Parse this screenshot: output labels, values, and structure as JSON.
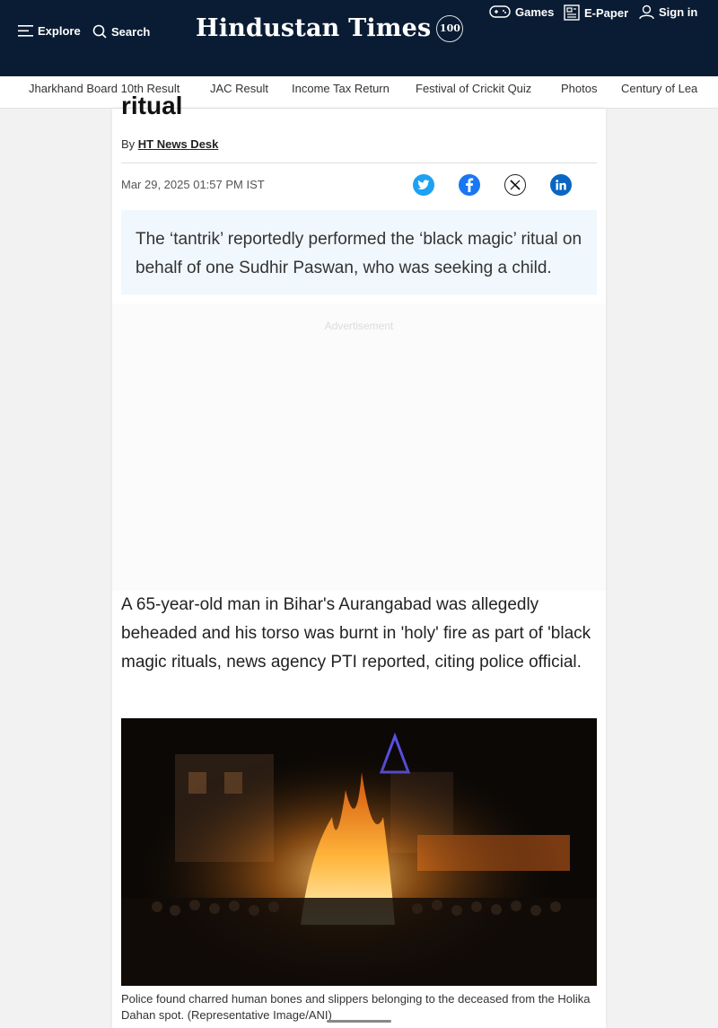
{
  "header": {
    "explore_label": "Explore",
    "search_label": "Search",
    "logo_text": "Hindustan Times",
    "logo_badge": "100",
    "games_label": "Games",
    "epaper_label": "E-Paper",
    "signin_label": "Sign in"
  },
  "nav": {
    "items": [
      "Jharkhand Board 10th Result",
      "JAC Result",
      "Income Tax Return",
      "Festival of Crickit Quiz",
      "Photos",
      "Century of Lea"
    ]
  },
  "article": {
    "title_fragment": "ritual",
    "byline_prefix": "By",
    "author": "HT News Desk",
    "date": "Mar 29, 2025 01:57 PM IST",
    "summary": "The ‘tantrik’ reportedly performed the ‘black magic’ ritual on behalf of one Sudhir Paswan, who was seeking a child.",
    "ad_label": "Advertisement",
    "paragraph": "A 65-year-old man in Bihar's Aurangabad was allegedly beheaded and his torso was burnt in 'holy' fire as part of 'black magic rituals, news agency PTI reported, citing police official.",
    "caption": "Police found charred human bones and slippers belonging to the deceased from the Holika Dahan spot. (Representative Image/ANI)"
  },
  "share_icons": [
    "twitter-icon",
    "facebook-icon",
    "x-icon",
    "linkedin-icon"
  ],
  "colors": {
    "header_bg": "#0a1c33",
    "summary_bg": "#f0f7fd",
    "twitter": "#1da1f2",
    "facebook": "#1877f2",
    "linkedin": "#0a66c2"
  }
}
